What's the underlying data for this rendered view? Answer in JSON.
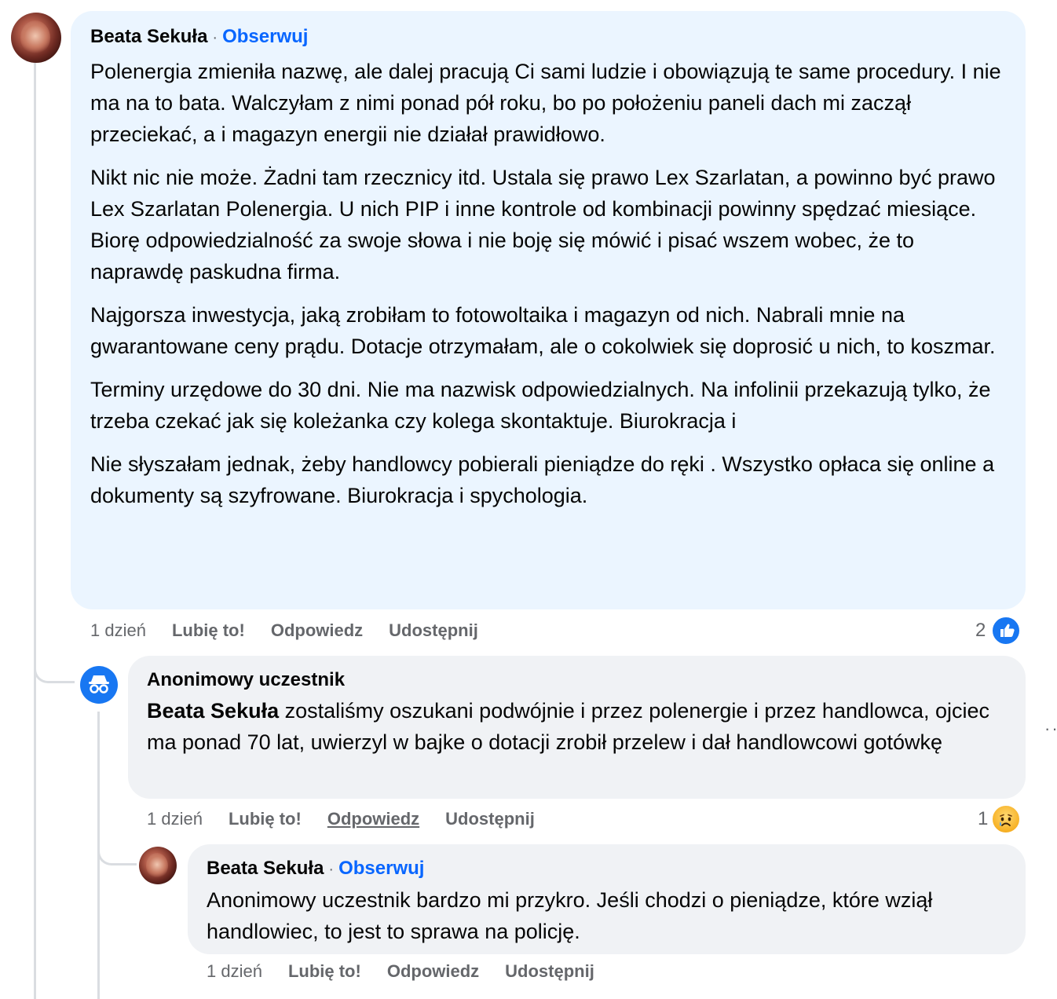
{
  "comments": [
    {
      "author": "Beata Sekuła",
      "separator": "·",
      "follow_label": "Obserwuj",
      "paragraphs": [
        "Polenergia zmieniła nazwę, ale dalej pracują Ci sami ludzie i obowiązują te same procedury. I nie ma na to bata. Walczyłam z nimi ponad pół roku, bo po położeniu paneli dach mi zaczął przeciekać, a i magazyn energii nie działał prawidłowo.",
        "Nikt nic nie może. Żadni tam rzecznicy itd. Ustala się prawo Lex Szarlatan, a powinno być prawo Lex Szarlatan Polenergia. U nich PIP i inne kontrole od kombinacji powinny spędzać miesiące.",
        "Biorę odpowiedzialność za swoje słowa i nie boję się mówić i pisać wszem wobec, że to naprawdę paskudna firma.",
        "Najgorsza inwestycja, jaką zrobiłam to fotowoltaika i magazyn od nich. Nabrali mnie na gwarantowane ceny prądu. Dotacje otrzymałam, ale o cokolwiek się doprosić u nich, to koszmar.",
        "Terminy urzędowe do 30 dni. Nie ma nazwisk odpowiedzialnych. Na infolinii przekazują tylko, że trzeba czekać jak się koleżanka czy kolega skontaktuje. Biurokracja i",
        "Nie słyszałam jednak, żeby handlowcy pobierali pieniądze do ręki . Wszystko opłaca się online a dokumenty są szyfrowane. Biurokracja i spychologia."
      ],
      "time": "1 dzień",
      "like_label": "Lubię to!",
      "reply_label": "Odpowiedz",
      "share_label": "Udostępnij",
      "reaction_count": "2",
      "reaction_icon": "like-icon"
    },
    {
      "author": "Anonimowy uczestnik",
      "mention": "Beata Sekuła",
      "text": " zostaliśmy oszukani podwójnie i przez polenergie i przez handlowca, ojciec ma ponad 70 lat, uwierzyl w bajke o dotacji zrobił przelew i dał handlowcowi gotówkę",
      "time": "1 dzień",
      "like_label": "Lubię to!",
      "reply_label": "Odpowiedz",
      "share_label": "Udostępnij",
      "reaction_count": "1",
      "reaction_icon": "sad-icon"
    },
    {
      "author": "Beata Sekuła",
      "separator": "·",
      "follow_label": "Obserwuj",
      "text": "Anonimowy uczestnik bardzo mi przykro. Jeśli chodzi o pieniądze, które wziął handlowiec, to jest to sprawa na policję.",
      "time": "1 dzień",
      "like_label": "Lubię to!",
      "reply_label": "Odpowiedz",
      "share_label": "Udostępnij"
    }
  ],
  "more_icon": "more-options-icon",
  "colors": {
    "main_bubble": "#ebf5ff",
    "reply_bubble": "#f0f2f5",
    "link": "#0866ff",
    "meta": "#65676b",
    "brand_blue": "#1877f2"
  }
}
